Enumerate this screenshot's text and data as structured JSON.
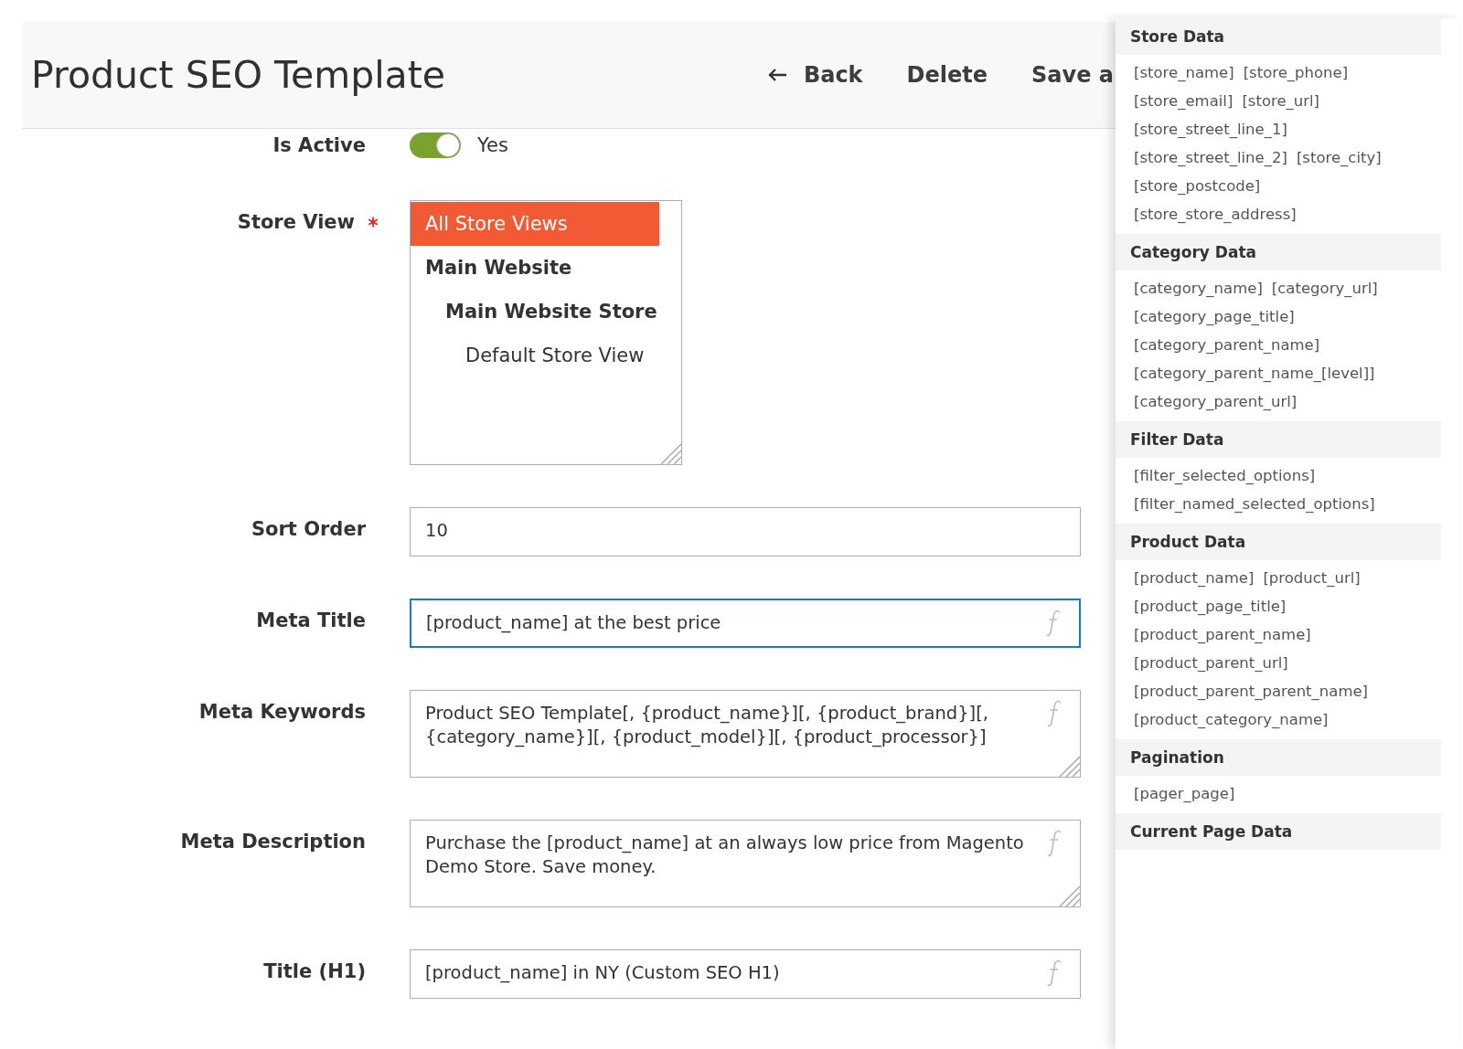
{
  "header": {
    "title": "Product SEO Template",
    "buttons": [
      {
        "label": "Back"
      },
      {
        "label": "Delete"
      },
      {
        "label": "Save a"
      }
    ]
  },
  "form": [
    {
      "kind": "toggle",
      "label": "Is Active",
      "on": true,
      "value": "Yes"
    },
    {
      "kind": "multiselect",
      "label": "Store View",
      "required": true,
      "options": [
        {
          "label": "All Store Views",
          "selected": true
        },
        {
          "label": "Main Website",
          "selected": false,
          "children": [
            {
              "label": "Main Website Store",
              "selected": false,
              "children": [
                {
                  "label": "Default Store View",
                  "selected": false
                }
              ]
            }
          ]
        }
      ]
    },
    {
      "kind": "text",
      "label": "Sort Order",
      "value": "10",
      "focused": false
    },
    {
      "kind": "text",
      "label": "Meta Title",
      "value": "[product_name] at the best price",
      "focused": true,
      "formula": true
    },
    {
      "kind": "textarea",
      "label": "Meta Keywords",
      "value": "Product SEO Template[, {product_name}][, {product_brand}][, {category_name}][, {product_model}][, {product_processor}]",
      "focused": false,
      "formula": true
    },
    {
      "kind": "textarea",
      "label": "Meta Description",
      "value": "Purchase the [product_name] at an always low price from Magento Demo Store. Save money.",
      "focused": false,
      "formula": true
    },
    {
      "kind": "text",
      "label": "Title (H1)",
      "value": "[product_name] in NY (Custom SEO H1)",
      "focused": false,
      "formula": true
    }
  ],
  "sidebar": [
    {
      "title": "Store Data",
      "rows": [
        [
          "[store_name]",
          "[store_phone]"
        ],
        [
          "[store_email]",
          "[store_url]"
        ],
        [
          "[store_street_line_1]"
        ],
        [
          "[store_street_line_2]",
          "[store_city]"
        ],
        [
          "[store_postcode]"
        ],
        [
          "[store_store_address]"
        ]
      ]
    },
    {
      "title": "Category Data",
      "rows": [
        [
          "[category_name]",
          "[category_url]"
        ],
        [
          "[category_page_title]"
        ],
        [
          "[category_parent_name]"
        ],
        [
          "[category_parent_name_[level]]"
        ],
        [
          "[category_parent_url]"
        ]
      ]
    },
    {
      "title": "Filter Data",
      "rows": [
        [
          "[filter_selected_options]"
        ],
        [
          "[filter_named_selected_options]"
        ]
      ]
    },
    {
      "title": "Product Data",
      "rows": [
        [
          "[product_name]",
          "[product_url]"
        ],
        [
          "[product_page_title]"
        ],
        [
          "[product_parent_name]"
        ],
        [
          "[product_parent_url]"
        ],
        [
          "[product_parent_parent_name]"
        ],
        [
          "[product_category_name]"
        ]
      ]
    },
    {
      "title": "Pagination",
      "rows": [
        [
          "[pager_page]"
        ]
      ]
    },
    {
      "title": "Current Page Data"
    }
  ]
}
